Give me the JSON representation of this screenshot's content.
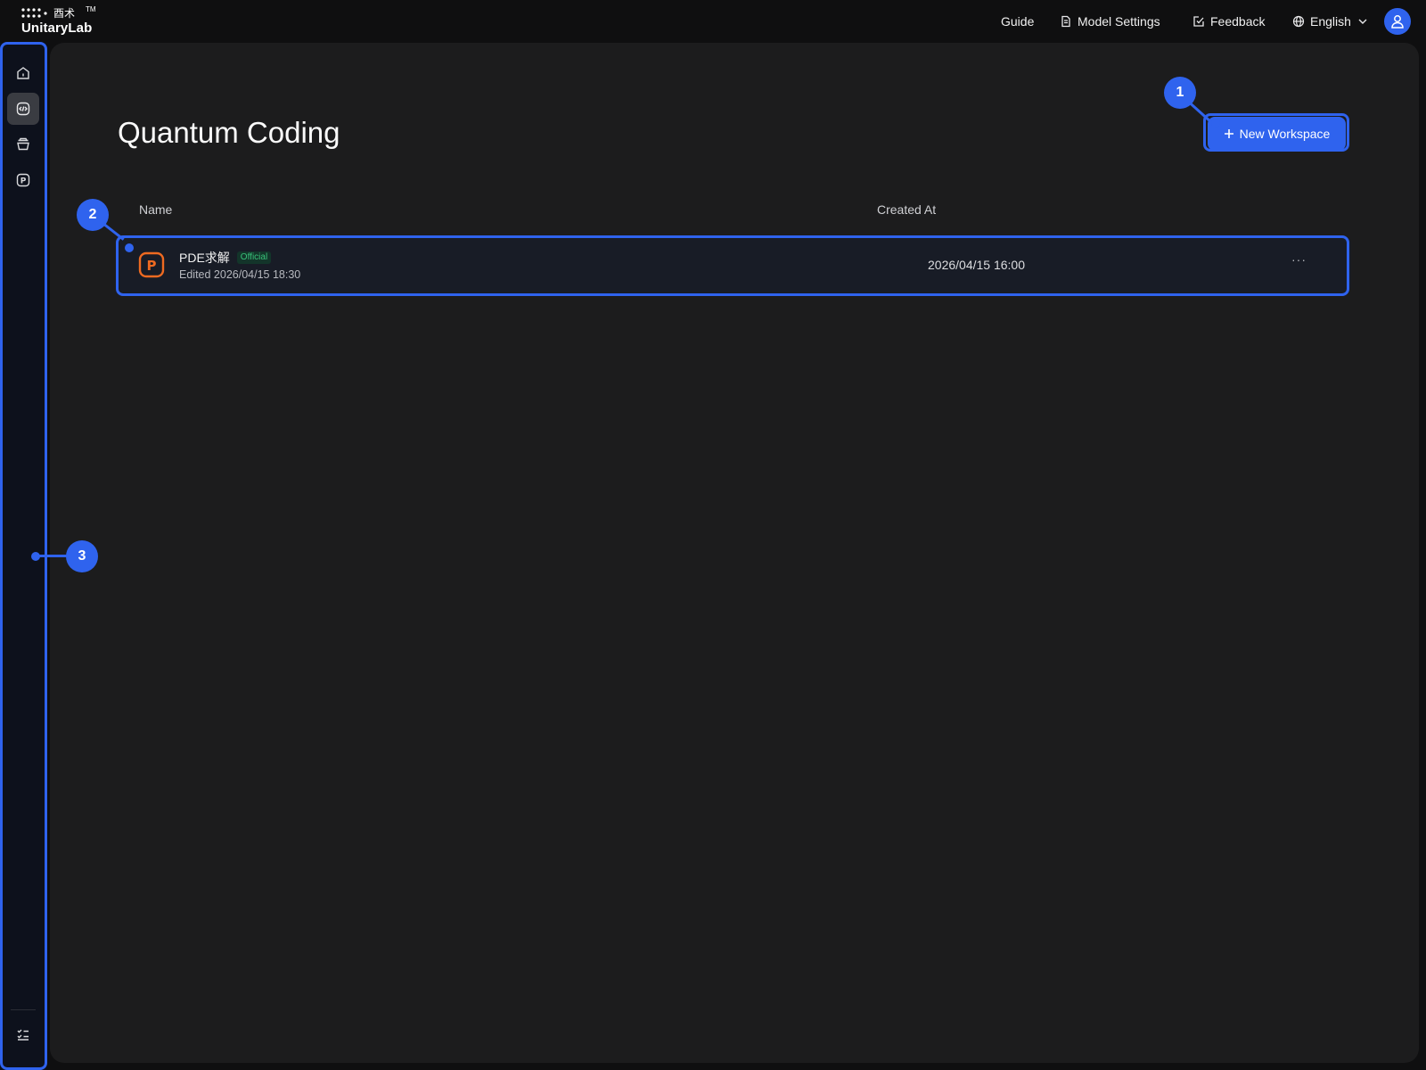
{
  "header": {
    "logo_cn": "酉术",
    "logo_tm": "TM",
    "logo_name": "UnitaryLab",
    "nav": {
      "guide": "Guide",
      "model_settings": "Model Settings",
      "feedback": "Feedback",
      "language": "English"
    },
    "icons": {
      "model_settings": "document-icon",
      "feedback": "edit-check-icon",
      "language": "globe-icon",
      "language_dropdown": "chevron-down-icon",
      "user": "user-icon"
    }
  },
  "sidebar": {
    "items": [
      {
        "icon": "home-icon",
        "active": false
      },
      {
        "icon": "code-icon",
        "active": true
      },
      {
        "icon": "layers-icon",
        "active": false
      },
      {
        "icon": "p-badge-icon",
        "active": false
      }
    ],
    "bottom_icon": "task-list-icon"
  },
  "main": {
    "title": "Quantum Coding",
    "new_workspace_label": "New Workspace",
    "columns": {
      "name": "Name",
      "created_at": "Created At"
    },
    "rows": [
      {
        "name": "PDE求解",
        "badge": "Official",
        "edited": "Edited 2026/04/15 18:30",
        "created_at": "2026/04/15 16:00",
        "more": "···",
        "icon": "p-badge-icon"
      }
    ]
  },
  "annotations": [
    "1",
    "2",
    "3"
  ],
  "colors": {
    "accent": "#2f63ee",
    "badge_green": "#39c27a",
    "row_icon_orange": "#ee6a21",
    "background": "#1c1c1d"
  }
}
